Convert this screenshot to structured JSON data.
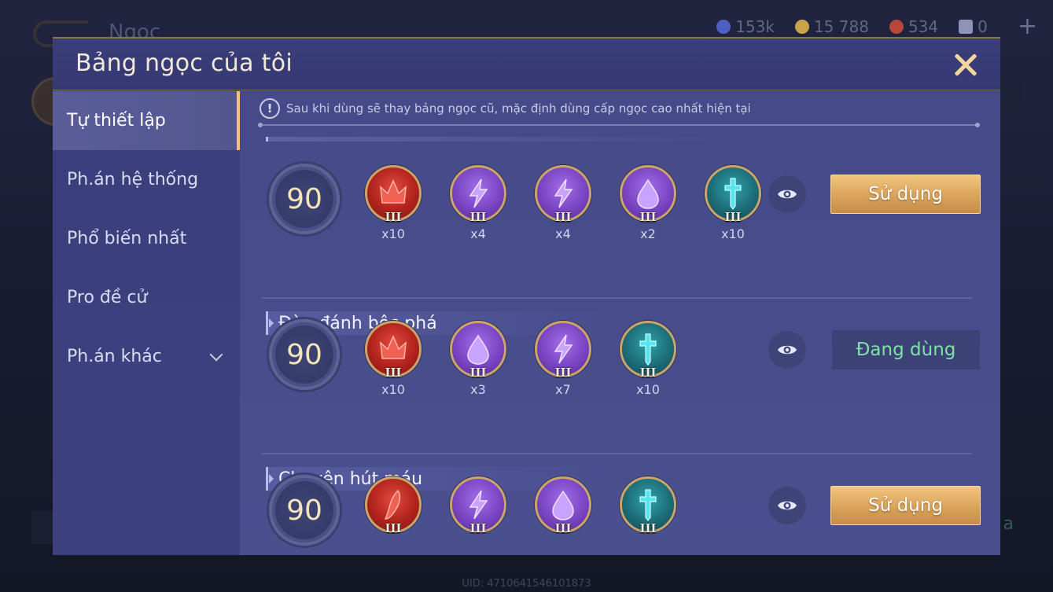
{
  "background": {
    "title": "Ngọc",
    "currencies": [
      {
        "icon": "blue-coin-icon",
        "color": "#4c5fc4",
        "value": "153k"
      },
      {
        "icon": "gold-coin-icon",
        "color": "#c9a24a",
        "value": "15 788"
      },
      {
        "icon": "red-gem-icon",
        "color": "#b8463d",
        "value": "534"
      },
      {
        "icon": "ticket-icon",
        "color": "#8d94b6",
        "value": "0"
      }
    ],
    "bottom_right_text": "a",
    "uid": "UID: 4710641546101873"
  },
  "modal": {
    "title": "Bảng ngọc của tôi",
    "close_icon": "close-icon"
  },
  "sidebar": {
    "items": [
      {
        "label": "Tự thiết lập",
        "active": true
      },
      {
        "label": "Ph.án hệ thống",
        "active": false
      },
      {
        "label": "Phổ biến nhất",
        "active": false
      },
      {
        "label": "Pro đề cử",
        "active": false
      },
      {
        "label": "Ph.án khác",
        "active": false,
        "expandable": true
      }
    ]
  },
  "notice": {
    "icon": "exclamation-icon",
    "text": "Sau khi dùng sẽ thay bảng ngọc cũ, mặc định dùng cấp ngọc cao nhất hiện tại"
  },
  "setups": [
    {
      "name": "",
      "level": "90",
      "gems": [
        {
          "color": "red",
          "icon": "crown-rune-icon",
          "tier": "III",
          "count": "x10"
        },
        {
          "color": "purple",
          "icon": "lightning-rune-icon",
          "tier": "III",
          "count": "x4"
        },
        {
          "color": "purple",
          "icon": "lightning-rune-icon",
          "tier": "III",
          "count": "x4"
        },
        {
          "color": "purple",
          "icon": "drop-rune-icon",
          "tier": "III",
          "count": "x2"
        },
        {
          "color": "teal",
          "icon": "sword-rune-icon",
          "tier": "III",
          "count": "x10"
        }
      ],
      "action": {
        "label": "Sử dụng",
        "state": "use"
      }
    },
    {
      "name": "Đòn đánh bộc phá",
      "level": "90",
      "gems": [
        {
          "color": "red",
          "icon": "crown-rune-icon",
          "tier": "III",
          "count": "x10"
        },
        {
          "color": "purple",
          "icon": "drop-rune-icon",
          "tier": "III",
          "count": "x3"
        },
        {
          "color": "purple",
          "icon": "lightning-rune-icon",
          "tier": "III",
          "count": "x7"
        },
        {
          "color": "teal",
          "icon": "sword-rune-icon",
          "tier": "III",
          "count": "x10"
        }
      ],
      "action": {
        "label": "Đang dùng",
        "state": "in-use"
      }
    },
    {
      "name": "Chuyên hút máu",
      "level": "90",
      "gems": [
        {
          "color": "red",
          "icon": "fang-rune-icon",
          "tier": "III",
          "count": ""
        },
        {
          "color": "purple",
          "icon": "lightning-rune-icon",
          "tier": "III",
          "count": ""
        },
        {
          "color": "purple",
          "icon": "drop-rune-icon",
          "tier": "III",
          "count": ""
        },
        {
          "color": "teal",
          "icon": "sword-rune-icon",
          "tier": "III",
          "count": ""
        }
      ],
      "action": {
        "label": "Sử dụng",
        "state": "use"
      }
    }
  ],
  "colors": {
    "accent_gold": "#f0c27a",
    "in_use_green": "#7ee2a6",
    "modal_bg": "#3f437f"
  }
}
